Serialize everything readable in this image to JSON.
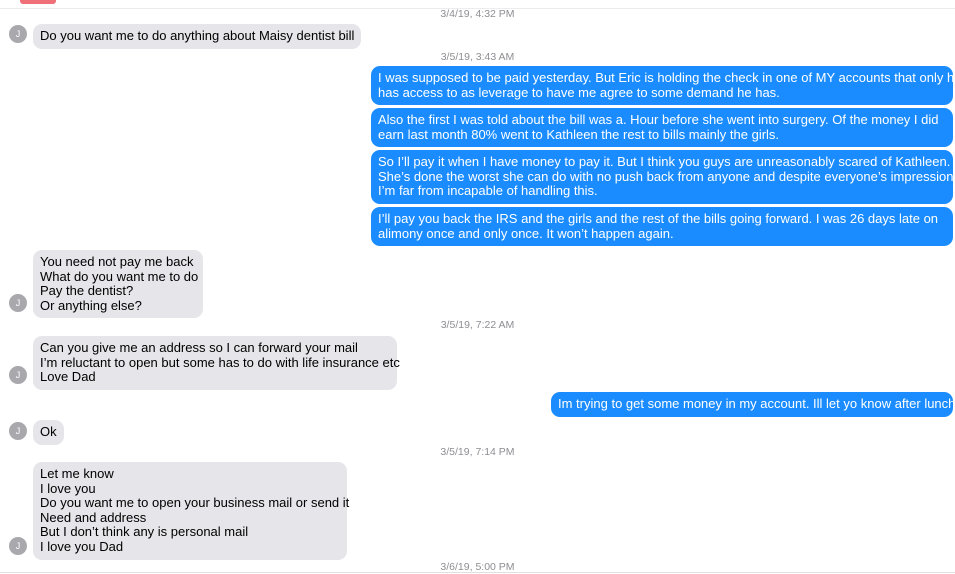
{
  "contact_initial": "J",
  "timestamps": {
    "t1": "3/4/19, 4:32 PM",
    "t2": "3/5/19, 3:43 AM",
    "t3": "3/5/19, 7:22 AM",
    "t4": "3/5/19, 7:14 PM",
    "t5": "3/6/19, 5:00 PM"
  },
  "messages": [
    {
      "lines": [
        "Do you want me to do anything about Maisy dentist bill"
      ]
    },
    {
      "lines": [
        "I was supposed to be paid yesterday. But Eric is holding the check in one of MY accounts that only he",
        "has access to as leverage to have me agree to some demand he has."
      ]
    },
    {
      "lines": [
        "Also the first I was told about the bill was a. Hour before she went into surgery. Of the money I did",
        "earn last month 80% went to Kathleen the rest to bills mainly the girls."
      ]
    },
    {
      "lines": [
        "So I’ll pay it when I have money to pay it. But I think you guys are unreasonably scared of Kathleen.",
        "She’s done the worst she can do with no push back from anyone and despite everyone’s impression",
        "I’m far from incapable of handling this."
      ]
    },
    {
      "lines": [
        "I’ll pay you back the IRS  and the girls and the rest of the bills going forward. I was 26 days late on",
        "alimony once and only once. It won’t happen again."
      ]
    },
    {
      "lines": [
        "You need not pay me  back",
        "What do you want me to do",
        "Pay the dentist?",
        "Or anything else?"
      ]
    },
    {
      "lines": [
        "Can you give me an address so I can forward your mail",
        "I’m reluctant to open but some has to do with life insurance etc",
        "Love Dad"
      ]
    },
    {
      "lines": [
        "Im trying to get some money in my account. Ill let yo know after lunch."
      ]
    },
    {
      "lines": [
        "Ok"
      ]
    },
    {
      "lines": [
        "Let me know",
        "I love you",
        "Do you want me to open your business mail or send it",
        "Need and address",
        "But I don’t think any is personal mail",
        "I love you Dad"
      ]
    }
  ]
}
